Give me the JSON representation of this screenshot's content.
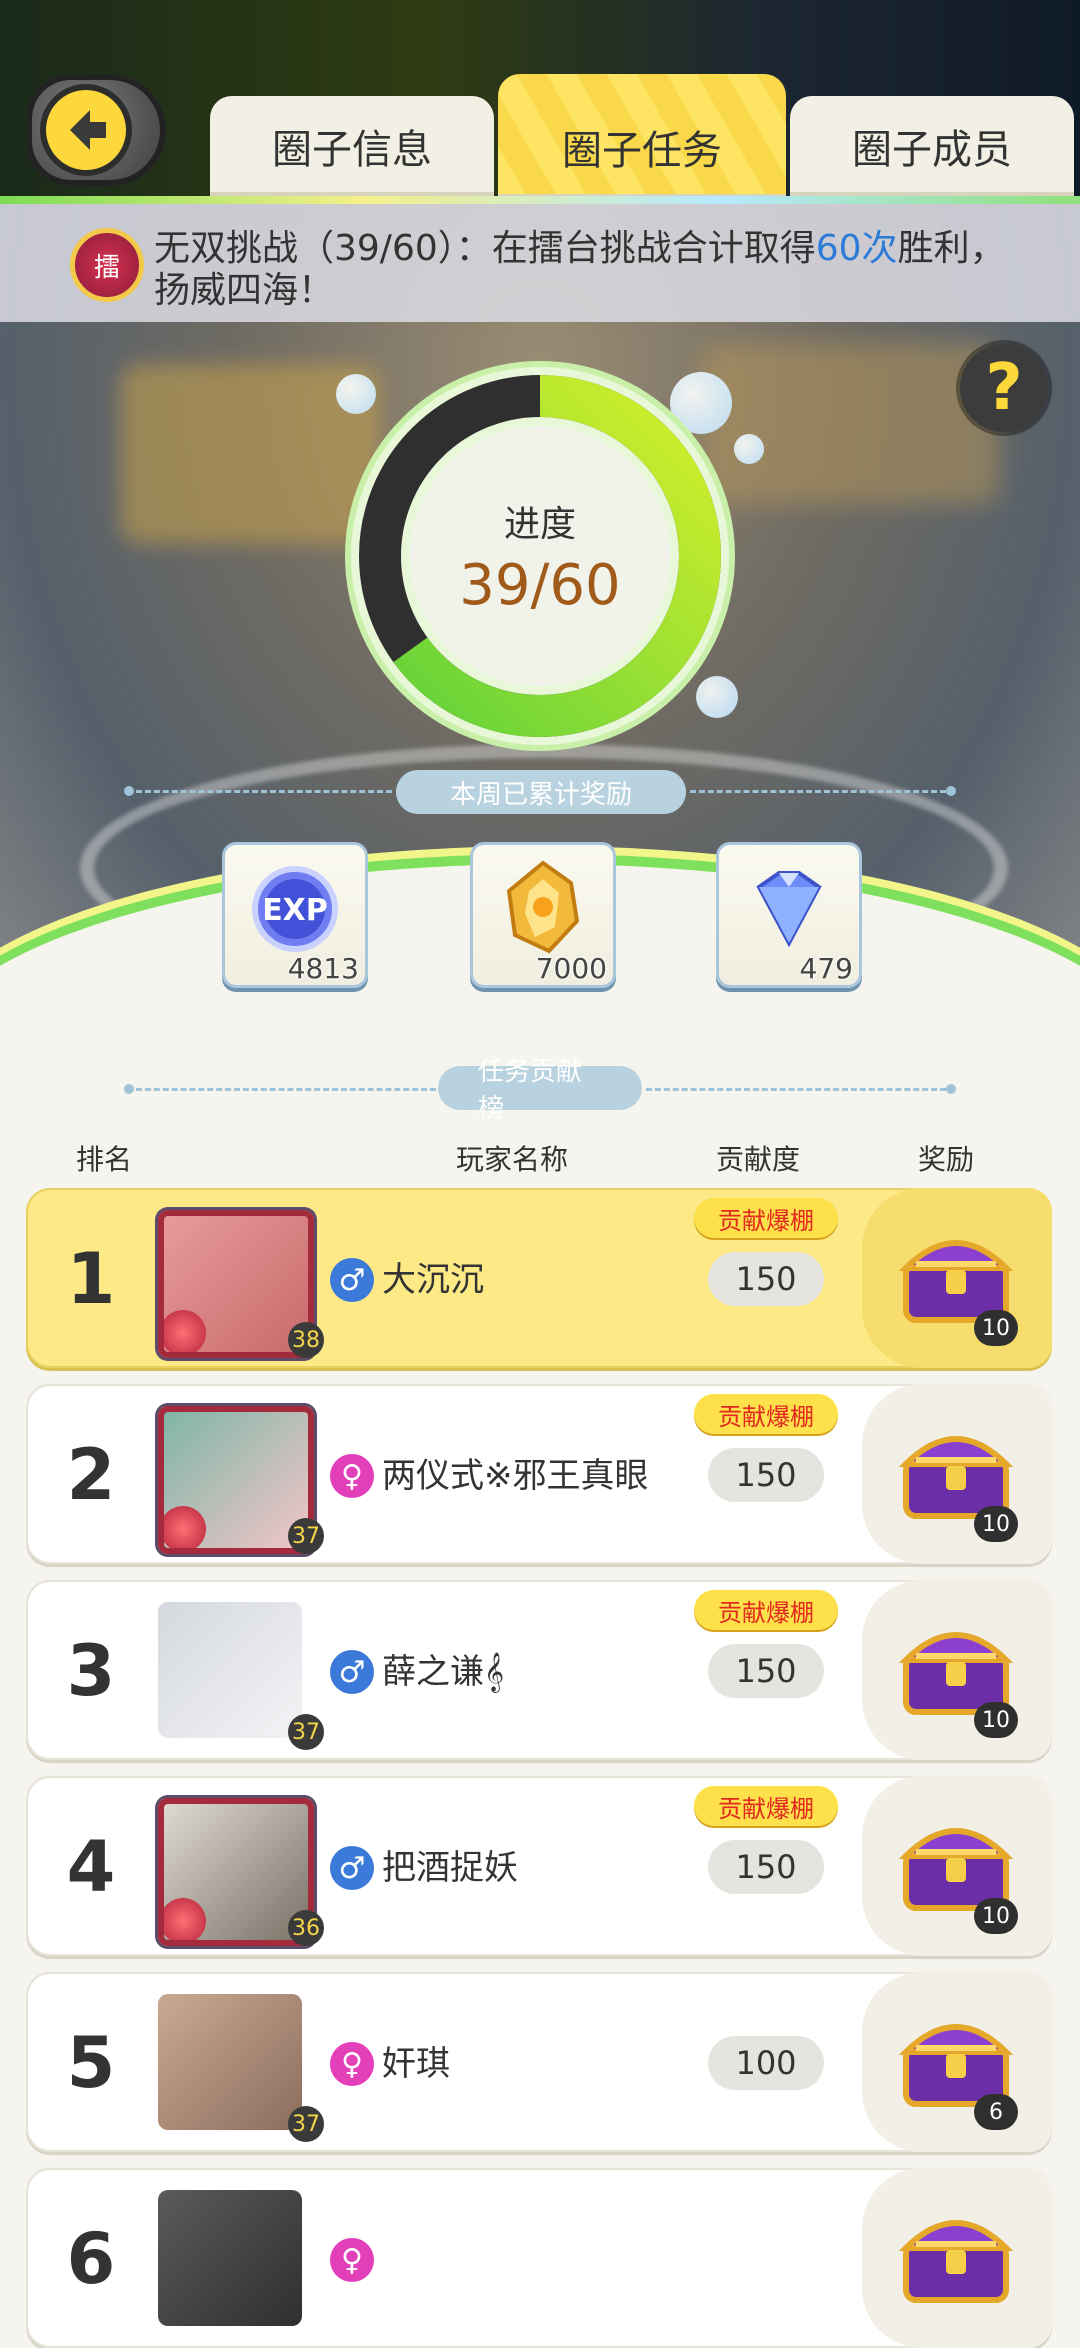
{
  "tabs": [
    {
      "label": "圈子信息",
      "active": false
    },
    {
      "label": "圈子任务",
      "active": true
    },
    {
      "label": "圈子成员",
      "active": false
    }
  ],
  "mission": {
    "badge_char": "擂",
    "text_before": "无双挑战（39/60）：在擂台挑战合计取得",
    "highlight": "60次",
    "text_after": "胜利，扬威四海！",
    "highlight_color": "#2c7bd8"
  },
  "progress": {
    "label": "进度",
    "value_text": "39/60",
    "current": 39,
    "total": 60
  },
  "weekly_rewards": {
    "title": "本周已累计奖励",
    "items": [
      {
        "icon": "exp-icon",
        "count": "4813"
      },
      {
        "icon": "gold-token-icon",
        "count": "7000"
      },
      {
        "icon": "diamond-icon",
        "count": "479"
      }
    ]
  },
  "leaderboard": {
    "title": "任务贡献榜",
    "columns": {
      "rank": "排名",
      "player": "玩家名称",
      "contribution": "贡献度",
      "reward": "奖励"
    },
    "tag_label": "贡献爆棚",
    "rows": [
      {
        "rank": "1",
        "gender": "♂",
        "name": "大沉沉",
        "score": "150",
        "tag": true,
        "level": "38",
        "chest": "10"
      },
      {
        "rank": "2",
        "gender": "♀",
        "name": "两仪式※邪王真眼",
        "score": "150",
        "tag": true,
        "level": "37",
        "chest": "10"
      },
      {
        "rank": "3",
        "gender": "♂",
        "name": "薛之谦𝄞",
        "score": "150",
        "tag": true,
        "level": "37",
        "chest": "10"
      },
      {
        "rank": "4",
        "gender": "♂",
        "name": "把酒捉妖",
        "score": "150",
        "tag": true,
        "level": "36",
        "chest": "10"
      },
      {
        "rank": "5",
        "gender": "♀",
        "name": "奸琪",
        "score": "100",
        "tag": false,
        "level": "37",
        "chest": "6"
      },
      {
        "rank": "6",
        "gender": "♀",
        "name": "",
        "score": "",
        "tag": false,
        "level": "",
        "chest": ""
      }
    ]
  },
  "colors": {
    "accent_yellow": "#fde563",
    "male": "#3b7ad8",
    "female": "#e23fb9",
    "progress_green": "#6ed43d"
  }
}
